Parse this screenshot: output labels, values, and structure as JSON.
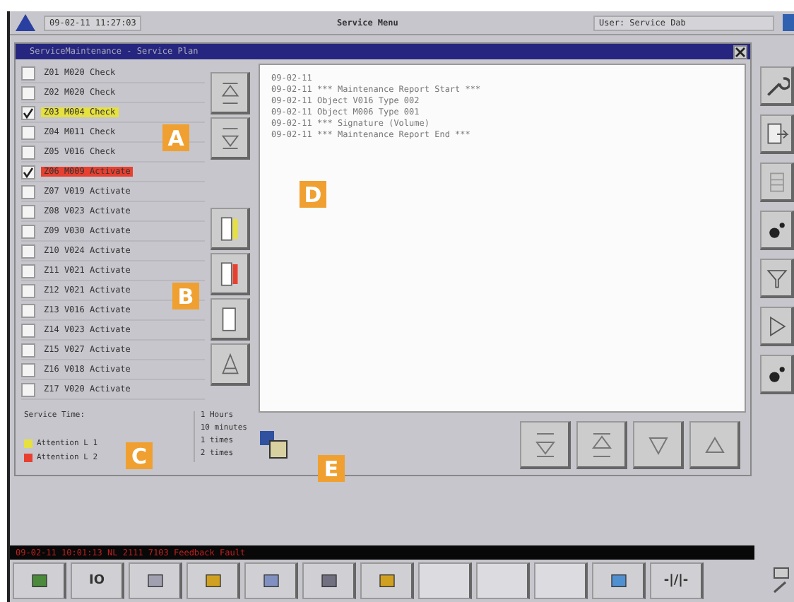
{
  "top_bar": {
    "datetime": "09-02-11 11:27:03",
    "title": "Service Menu",
    "user": "User: Service Dab"
  },
  "dialog": {
    "title": "ServiceMaintenance - Service Plan"
  },
  "items": [
    {
      "label": "Z01 M020 Check",
      "checked": false
    },
    {
      "label": "Z02 M020 Check",
      "checked": false
    },
    {
      "label": "Z03 M004 Check",
      "checked": true,
      "color": "#e6e040"
    },
    {
      "label": "Z04 M011 Check",
      "checked": false
    },
    {
      "label": "Z05 V016 Check",
      "checked": false
    },
    {
      "label": "Z06 M009 Activate",
      "checked": true,
      "color": "#e84030"
    },
    {
      "label": "Z07 V019 Activate",
      "checked": false
    },
    {
      "label": "Z08 V023 Activate",
      "checked": false
    },
    {
      "label": "Z09 V030 Activate",
      "checked": false
    },
    {
      "label": "Z10 V024 Activate",
      "checked": false
    },
    {
      "label": "Z11 V021 Activate",
      "checked": false
    },
    {
      "label": "Z12 V021 Activate",
      "checked": false
    },
    {
      "label": "Z13 V016 Activate",
      "checked": false
    },
    {
      "label": "Z14 V023 Activate",
      "checked": false
    },
    {
      "label": "Z15 V027 Activate",
      "checked": false
    },
    {
      "label": "Z16 V018 Activate",
      "checked": false
    },
    {
      "label": "Z17 V020 Activate",
      "checked": false
    }
  ],
  "legend": {
    "title": "Service Time:",
    "levels": [
      {
        "label": "Attention L 1",
        "color": "#e6e040"
      },
      {
        "label": "Attention L 2",
        "color": "#e84030"
      }
    ],
    "units": [
      "1 Hours",
      "10 minutes",
      "1 times",
      "2 times"
    ]
  },
  "report": [
    "09-02-11",
    "09-02-11 *** Maintenance Report Start ***",
    "09-02-11 Object V016 Type 002",
    "09-02-11 Object M006 Type 001",
    "09-02-11 *** Signature (Volume)",
    "09-02-11 *** Maintenance Report End ***"
  ],
  "alarm": "09-02-11 10:01:13 NL 2111 7103 Feedback Fault",
  "taskbar": [
    {
      "kind": "icon"
    },
    {
      "kind": "text",
      "label": "IO"
    },
    {
      "kind": "icon"
    },
    {
      "kind": "icon"
    },
    {
      "kind": "icon"
    },
    {
      "kind": "icon"
    },
    {
      "kind": "icon"
    },
    {
      "kind": "empty"
    },
    {
      "kind": "empty"
    },
    {
      "kind": "empty"
    },
    {
      "kind": "icon"
    },
    {
      "kind": "text",
      "label": "-|/|-"
    }
  ],
  "callouts": [
    "A",
    "B",
    "C",
    "D",
    "E"
  ]
}
